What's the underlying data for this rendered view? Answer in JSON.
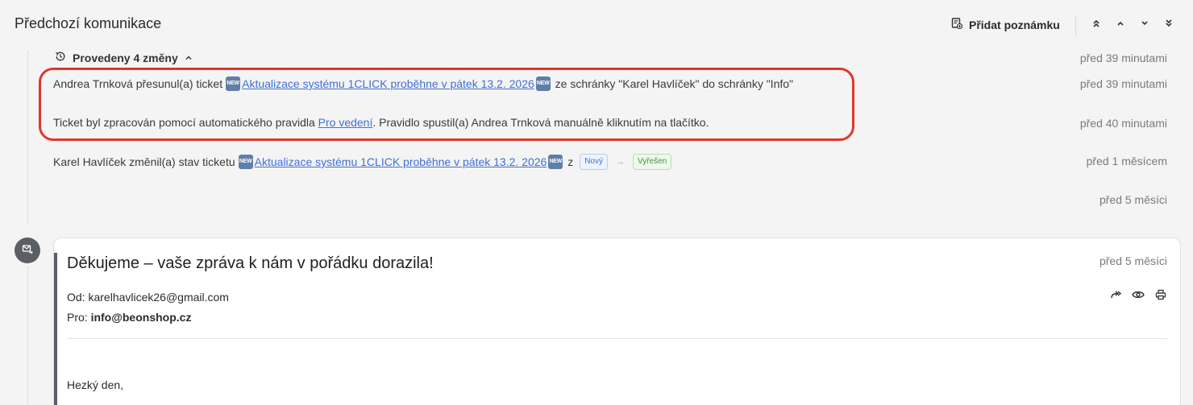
{
  "header": {
    "title": "Předchozí komunikace",
    "add_note_label": "Přidat poznámku",
    "nav_icons": [
      "double-chevron-up-icon",
      "chevron-up-icon",
      "chevron-down-icon",
      "double-chevron-down-icon"
    ]
  },
  "changes": {
    "toggle_label": "Provedeny 4 změny",
    "toggle_time": "před 39 minutami",
    "items": [
      {
        "prefix": "Andrea Trnková přesunul(a) ticket",
        "badge": "NEW",
        "link": " Aktualizace systému 1CLICK proběhne v pátek 13.2. 2026 ",
        "suffix": " ze schránky \"Karel Havlíček\" do schránky \"Info\"",
        "time": "před 39 minutami"
      },
      {
        "prefix": "Ticket byl zpracován pomocí automatického pravidla ",
        "link": "Pro vedení",
        "suffix": ". Pravidlo spustil(a) Andrea Trnková manuálně kliknutím na tlačítko.",
        "time": "před 40 minutami"
      },
      {
        "prefix": "Karel Havlíček změnil(a) stav ticketu",
        "badge": "NEW",
        "link": " Aktualizace systému 1CLICK proběhne v pátek 13.2. 2026 ",
        "middle": " z",
        "status_from": "Nový",
        "status_to": "Vyřešen",
        "time": "před 1 měsícem"
      }
    ],
    "trailing_time": "před 5 měsíci"
  },
  "email": {
    "subject": "Děkujeme – vaše zpráva k nám v pořádku dorazila!",
    "time": "před 5 měsíci",
    "from_label": "Od: ",
    "from_value": "karelhavlicek26@gmail.com",
    "to_label": "Pro: ",
    "to_value": "info@beonshop.cz",
    "greeting": "Hezký den,",
    "action_icons": [
      "forward-icon",
      "eye-icon",
      "print-icon"
    ]
  },
  "colors": {
    "link": "#3f6fd8",
    "highlight": "#e0372a",
    "status_new": "#3f6fd8",
    "status_solved": "#3c9a33"
  }
}
